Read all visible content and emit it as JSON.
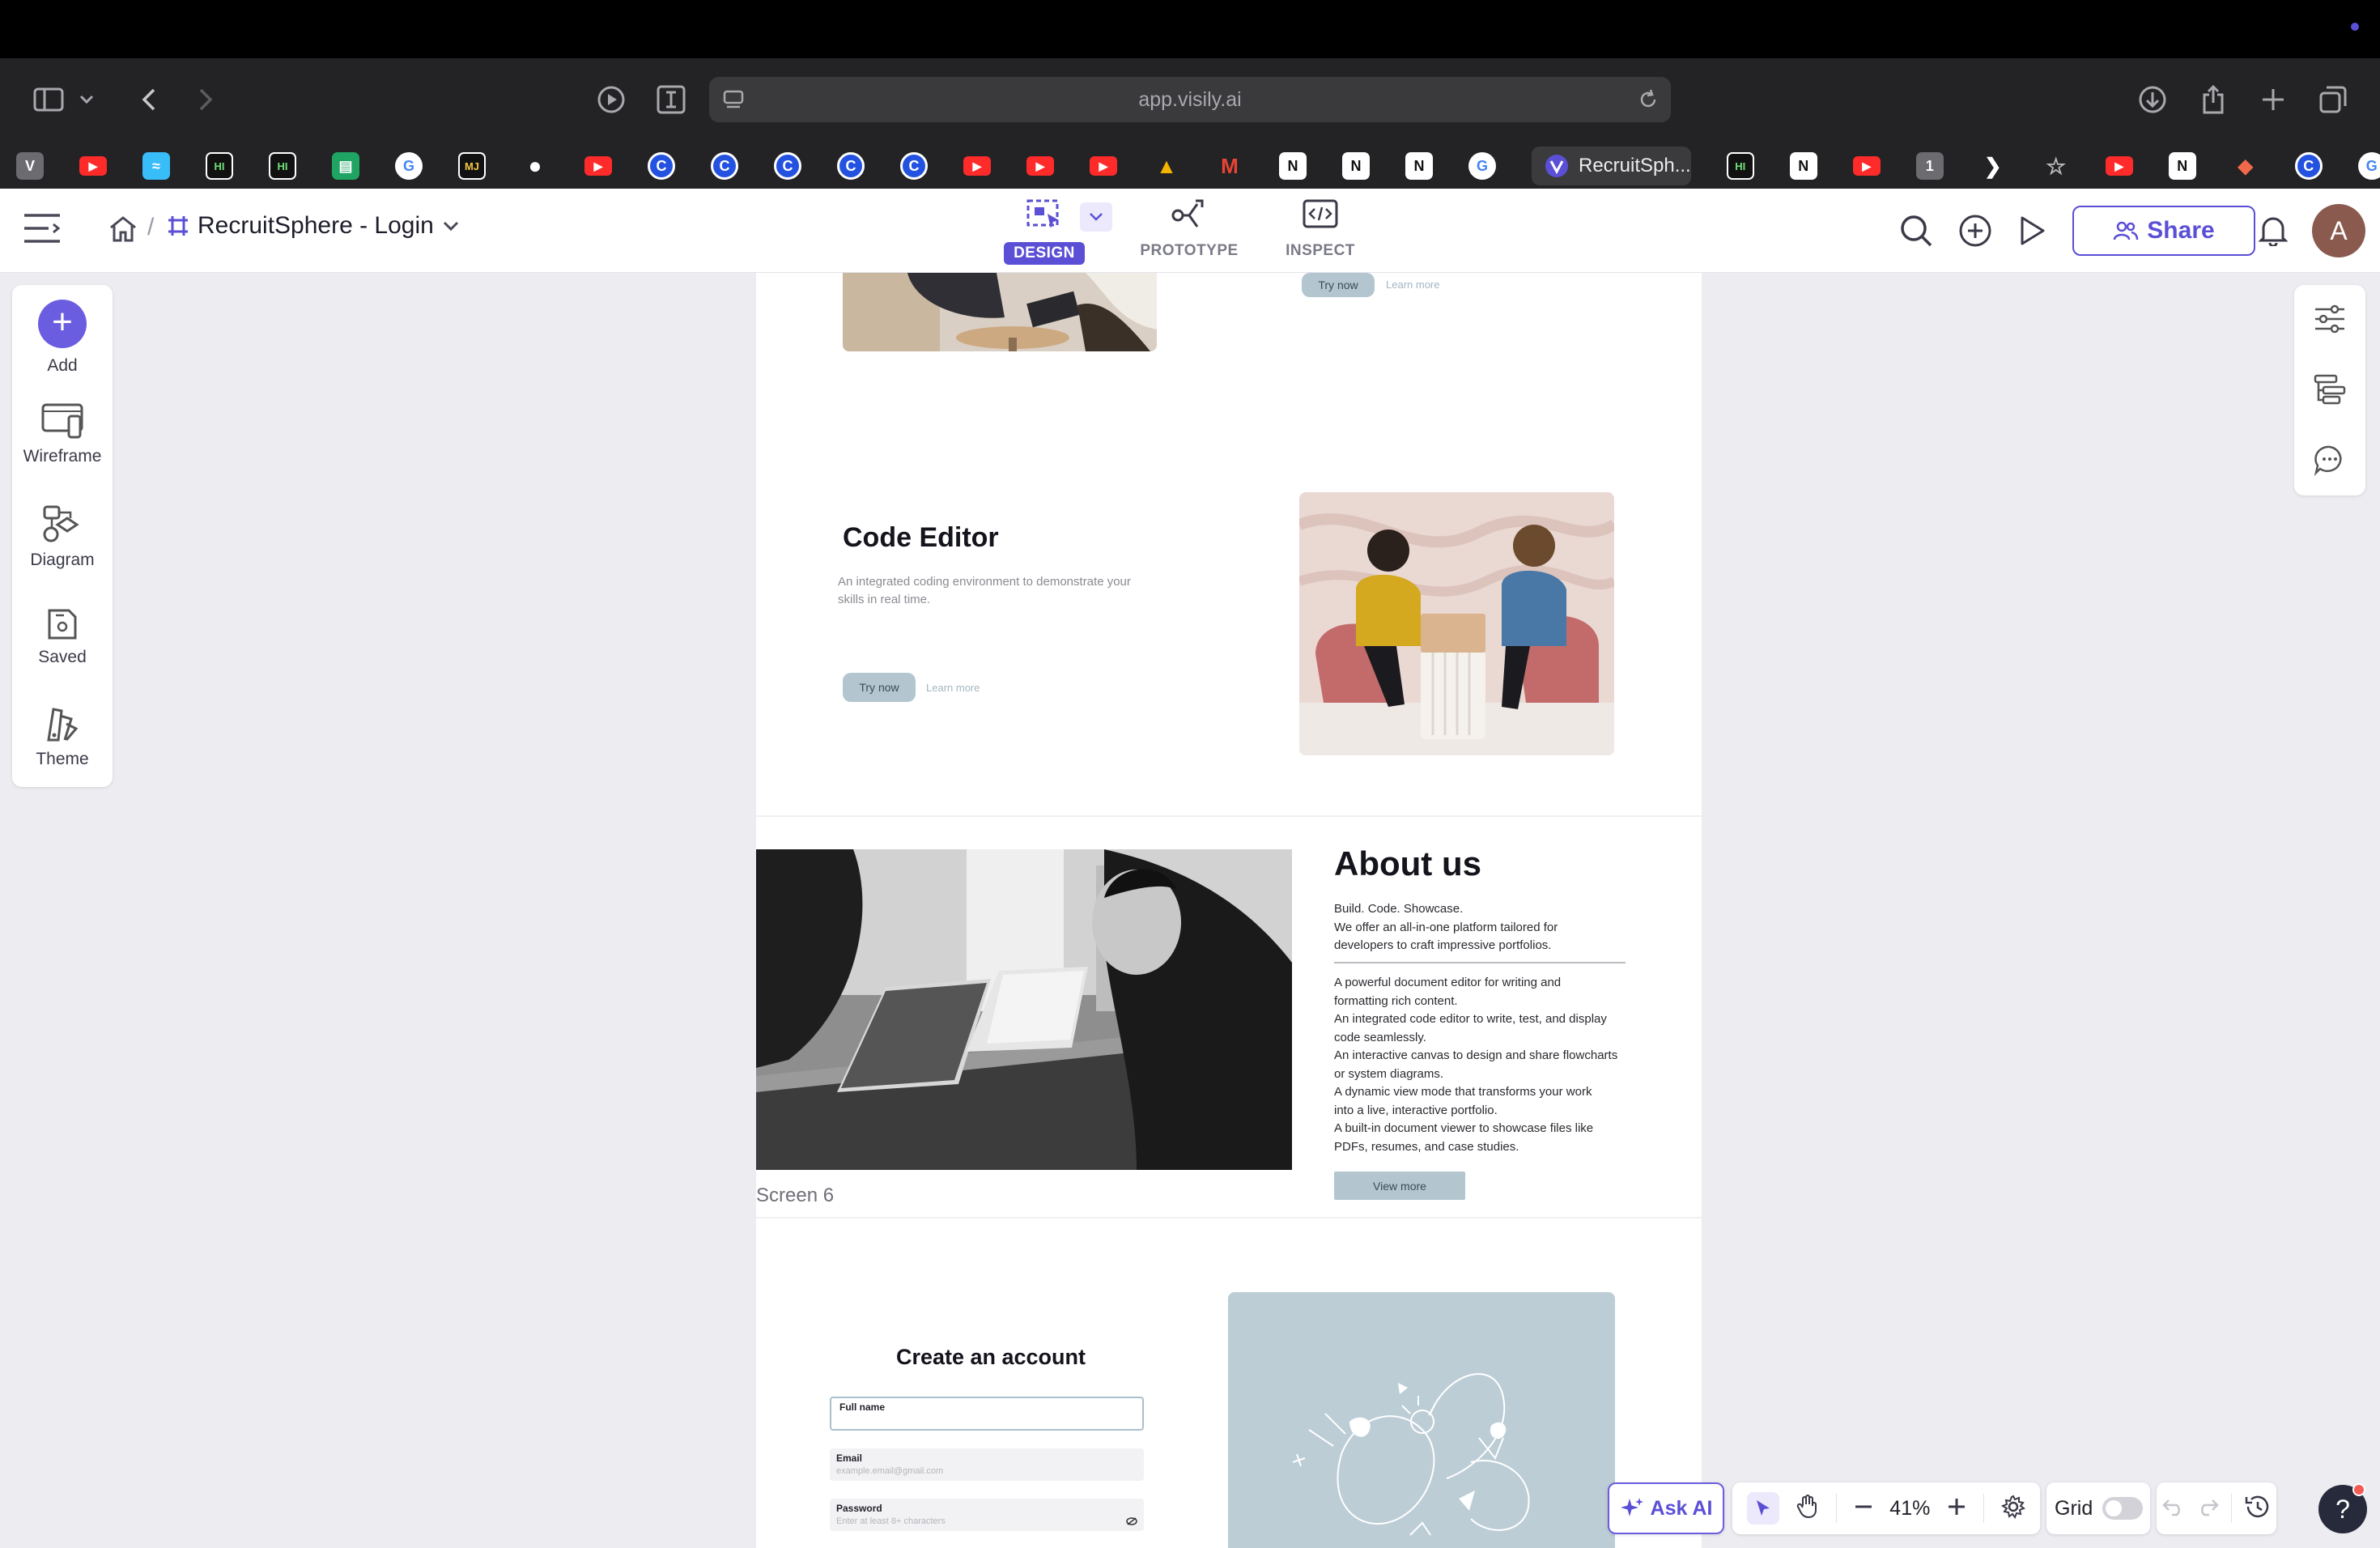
{
  "browser": {
    "url": "app.visily.ai",
    "active_tab_label": "RecruitSph...",
    "bookmark_icons": [
      "V",
      "yt",
      "tw",
      "hi",
      "hi",
      "sheets",
      "G",
      "MJ",
      "gh",
      "yt",
      "C",
      "C",
      "C",
      "C",
      "C",
      "yt",
      "yt",
      "yt",
      "drive",
      "gmail",
      "N",
      "N",
      "N",
      "G"
    ],
    "bookmark_icons_after": [
      "hi",
      "N",
      "yt",
      "1",
      "x",
      "star",
      "yt",
      "N",
      "figma",
      "C",
      "G"
    ],
    "bookmark_colors": {
      "V": "#6b6b70",
      "yt": "#ff2a2a",
      "tw": "#38bdf8",
      "hi": "#111111",
      "sheets": "#1fa463",
      "G": "#ffffff",
      "MJ": "#111111",
      "gh": "#232325",
      "C": "#2452e0",
      "drive": "#232325",
      "gmail": "#232325",
      "N": "#ffffff",
      "1": "#6b6b70",
      "x": "#232325",
      "star": "#232325",
      "figma": "#232325"
    }
  },
  "header": {
    "breadcrumb_title": "RecruitSphere - Login",
    "modes": [
      {
        "label": "DESIGN",
        "active": true
      },
      {
        "label": "PROTOTYPE",
        "active": false
      },
      {
        "label": "INSPECT",
        "active": false
      }
    ],
    "share_label": "Share",
    "avatar_initial": "A"
  },
  "left_panel": {
    "items": [
      {
        "label": "Add",
        "icon": "plus-icon"
      },
      {
        "label": "Wireframe",
        "icon": "wireframe-icon"
      },
      {
        "label": "Diagram",
        "icon": "diagram-icon"
      },
      {
        "label": "Saved",
        "icon": "saved-icon"
      },
      {
        "label": "Theme",
        "icon": "theme-icon"
      }
    ]
  },
  "canvas": {
    "top_card": {
      "try_label": "Try now",
      "learn_label": "Learn more"
    },
    "code_editor": {
      "title": "Code Editor",
      "desc_line1": "An integrated coding environment to demonstrate your",
      "desc_line2": "skills in real time.",
      "try_label": "Try now",
      "learn_label": "Learn more"
    },
    "about": {
      "title": "About us",
      "intro": [
        "Build. Code. Showcase.",
        "We offer an all-in-one platform tailored for",
        "developers to craft impressive portfolios."
      ],
      "features": [
        "A powerful document editor for writing and",
        "formatting rich content.",
        "An integrated code editor to write, test, and display",
        "code seamlessly.",
        "An interactive canvas to design and share flowcharts",
        "or system diagrams.",
        "A dynamic view mode that transforms your work",
        "into a live, interactive portfolio.",
        "A built-in document viewer to showcase files like",
        "PDFs, resumes, and case studies."
      ],
      "view_more_label": "View more"
    },
    "screen_label": "Screen 6",
    "signup": {
      "title": "Create an account",
      "full_name_label": "Full name",
      "email_label": "Email",
      "email_placeholder": "example.email@gmail.com",
      "password_label": "Password",
      "password_placeholder": "Enter at least 8+ characters"
    }
  },
  "bottom_toolbar": {
    "ask_ai_label": "Ask AI",
    "zoom": "41%",
    "grid_label": "Grid",
    "grid_on": false
  },
  "colors": {
    "accent": "#5b4fd6",
    "button_muted": "#b3c6cf",
    "illustration_bg": "#bccdd6"
  }
}
